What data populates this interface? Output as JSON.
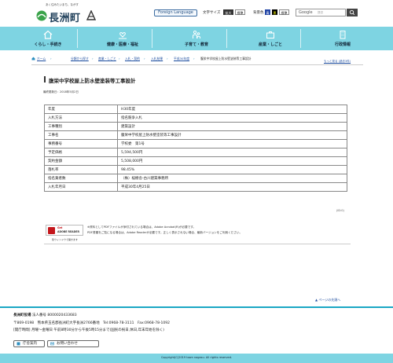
{
  "header": {
    "logo_tagline": "あく住みたいまち、ながす",
    "logo_text": "長洲町",
    "foreign_language": "Foreign Language",
    "text_size_label": "文字サイズ",
    "text_size_large": "拡大",
    "text_size_std": "標準",
    "bg_color_label": "背景色",
    "bg_blue": "青",
    "bg_black": "黒",
    "bg_std": "標準",
    "search_google": "Google",
    "search_sub": "提供"
  },
  "nav": {
    "items": [
      {
        "label": "くらし・手続き",
        "icon": "house-icon"
      },
      {
        "label": "健康・医療・福祉",
        "icon": "heart-hands-icon"
      },
      {
        "label": "子育て・教育",
        "icon": "family-icon"
      },
      {
        "label": "産業・しごと",
        "icon": "briefcase-icon"
      },
      {
        "label": "行政情報",
        "icon": "building-icon"
      }
    ]
  },
  "breadcrumb": {
    "home": "ホーム",
    "items": [
      "分類から探す",
      "産業・しごと",
      "入札・契約",
      "入札結果",
      "平成30年度"
    ],
    "current": "腹栄中学校屋上防水壁塗装等工事設計"
  },
  "font_size_link": "もっと見る (過去3件)",
  "page": {
    "title": "腹栄中学校屋上防水壁塗装等工事設計",
    "updated": "最終更新日：2018年5月2日"
  },
  "table": {
    "rows": [
      {
        "k": "年度",
        "v": "H30年度"
      },
      {
        "k": "入札方法",
        "v": "指名競争入札"
      },
      {
        "k": "工事種別",
        "v": "建築設計"
      },
      {
        "k": "工事名",
        "v": "腹栄中学校屋上防水壁塗装等工事設計"
      },
      {
        "k": "事務番号",
        "v": "学校委　第1号"
      },
      {
        "k": "予定価格",
        "v": "5,594,500円"
      },
      {
        "k": "契約金額",
        "v": "5,508,000円"
      },
      {
        "k": "落札率",
        "v": "98.45%"
      },
      {
        "k": "指名業者数",
        "v": "（株）桜樹舎-古川建築事務所"
      },
      {
        "k": "入札年月日",
        "v": "平成30年4月25日"
      }
    ]
  },
  "page_number": "(ID:0)",
  "pdf": {
    "badge_get": "Get",
    "badge_reader": "ADOBE READER",
    "new_window": "別ウィンドウで開きます",
    "line1": "※資料としてPDFファイルが添付されている場合は、Adobe Acrobat(R)が必要です。",
    "line2": "PDF書類をご覧になる場合は、Adobe Readerが必要です。正しく表示されない場合、最新バージョンをご利用ください。"
  },
  "back_to_top": "▲ ページの先頭へ",
  "footer": {
    "office_name": "長洲町役場",
    "corp_number": "法人番号 8000020433683",
    "address": "〒869-0198　熊本県玉名郡長洲町大字長洲2766番地　Tel:0968-78-3111　Fax:0968-78-1092",
    "hours": "[開庁時間] 月曜～金曜日 午前8時30分から午後5時15分まで(国民の祝日,休日,年末年始を除く)",
    "btn_guide": "庁舎案内",
    "btn_contact": "お問い合わせ",
    "copyright": "Copyright(C)2019 town nagasu. All rights reserved."
  },
  "colors": {
    "nav_bg": "#7ed4e2",
    "link": "#1f4fa0",
    "accent": "#1aa7c4"
  }
}
